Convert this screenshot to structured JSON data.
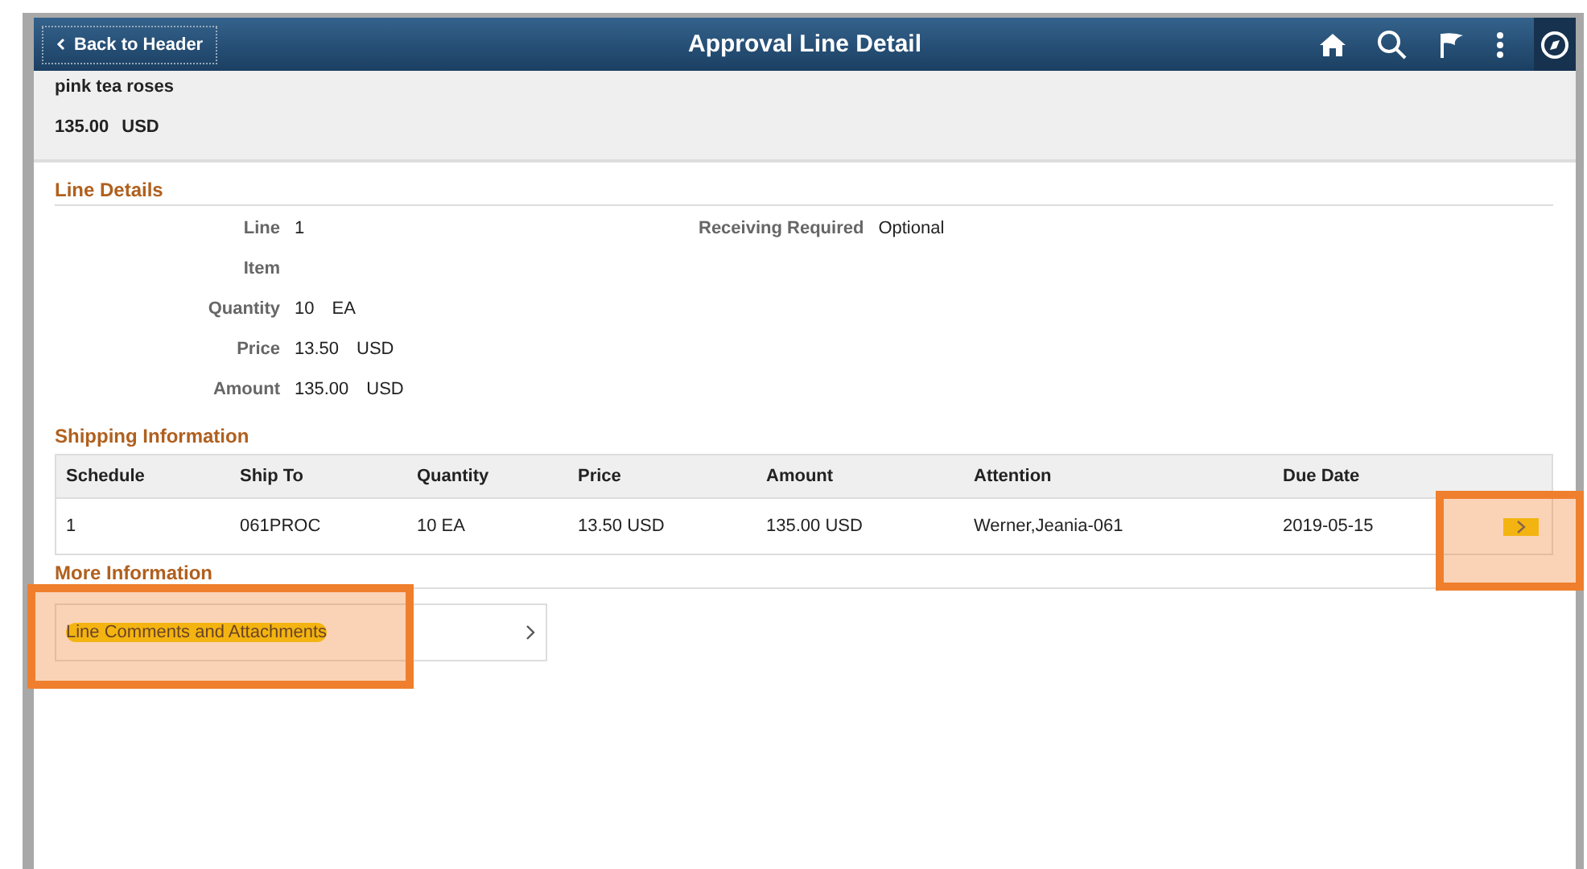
{
  "header": {
    "back_button": "Back to Header",
    "title": "Approval Line Detail"
  },
  "summary": {
    "description": "pink tea roses",
    "amount": "135.00",
    "currency": "USD"
  },
  "line_details": {
    "title": "Line Details",
    "left_fields": [
      {
        "label": "Line",
        "values": [
          "1"
        ]
      },
      {
        "label": "Item"
      },
      {
        "label": "Quantity",
        "values": [
          "10",
          "EA"
        ]
      },
      {
        "label": "Price",
        "values": [
          "13.50",
          "USD"
        ]
      },
      {
        "label": "Amount",
        "values": [
          "135.00",
          "USD"
        ]
      }
    ],
    "right_fields": [
      {
        "label": "Receiving Required",
        "values": [
          "Optional"
        ]
      }
    ]
  },
  "shipping": {
    "title": "Shipping Information",
    "columns": [
      "Schedule",
      "Ship To",
      "Quantity",
      "Price",
      "Amount",
      "Attention",
      "Due Date"
    ],
    "rows": [
      {
        "cells": [
          "1",
          "061PROC",
          "10 EA",
          "13.50 USD",
          "135.00 USD",
          "Werner,Jeania-061",
          "2019-05-15"
        ],
        "highlighted": true
      }
    ]
  },
  "more_info": {
    "title": "More Information",
    "links": [
      {
        "label": "Line Comments and Attachments",
        "highlighted": true
      }
    ]
  }
}
